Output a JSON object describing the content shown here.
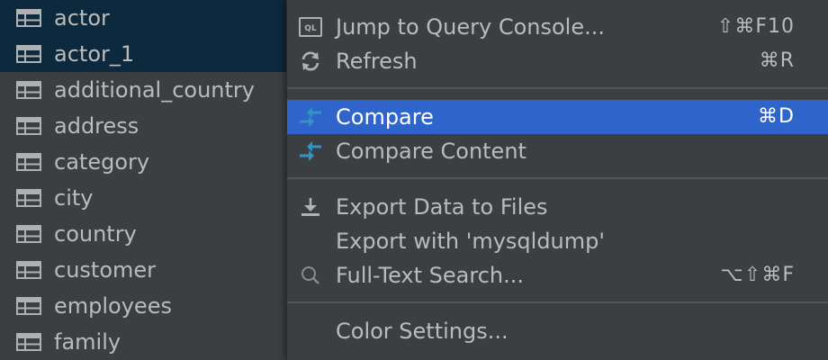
{
  "tree": {
    "items": [
      {
        "label": "actor",
        "selected": true
      },
      {
        "label": "actor_1",
        "selected": true
      },
      {
        "label": "additional_country"
      },
      {
        "label": "address"
      },
      {
        "label": "category"
      },
      {
        "label": "city"
      },
      {
        "label": "country"
      },
      {
        "label": "customer"
      },
      {
        "label": "employees"
      },
      {
        "label": "family"
      }
    ],
    "icon": "table-icon"
  },
  "menu": {
    "items": [
      {
        "label": "Jump to Query Console...",
        "shortcut": "⇧⌘F10",
        "icon": "query-console-icon"
      },
      {
        "label": "Refresh",
        "shortcut": "⌘R",
        "icon": "refresh-icon"
      },
      {
        "label": "Compare",
        "shortcut": "⌘D",
        "icon": "compare-icon",
        "active": true
      },
      {
        "label": "Compare Content",
        "shortcut": "",
        "icon": "compare-icon"
      },
      {
        "label": "Export Data to Files",
        "shortcut": "",
        "icon": "export-icon"
      },
      {
        "label": "Export with 'mysqldump'",
        "shortcut": "",
        "icon": ""
      },
      {
        "label": "Full-Text Search...",
        "shortcut": "⌥⇧⌘F",
        "icon": "search-icon"
      },
      {
        "label": "Color Settings...",
        "shortcut": "",
        "icon": ""
      }
    ]
  },
  "colors": {
    "background": "#3c3f41",
    "selection_tree": "#0d293e",
    "selection_menu": "#2f65ca",
    "text": "#bbbbbb",
    "compare_icon": "#3592c4"
  }
}
